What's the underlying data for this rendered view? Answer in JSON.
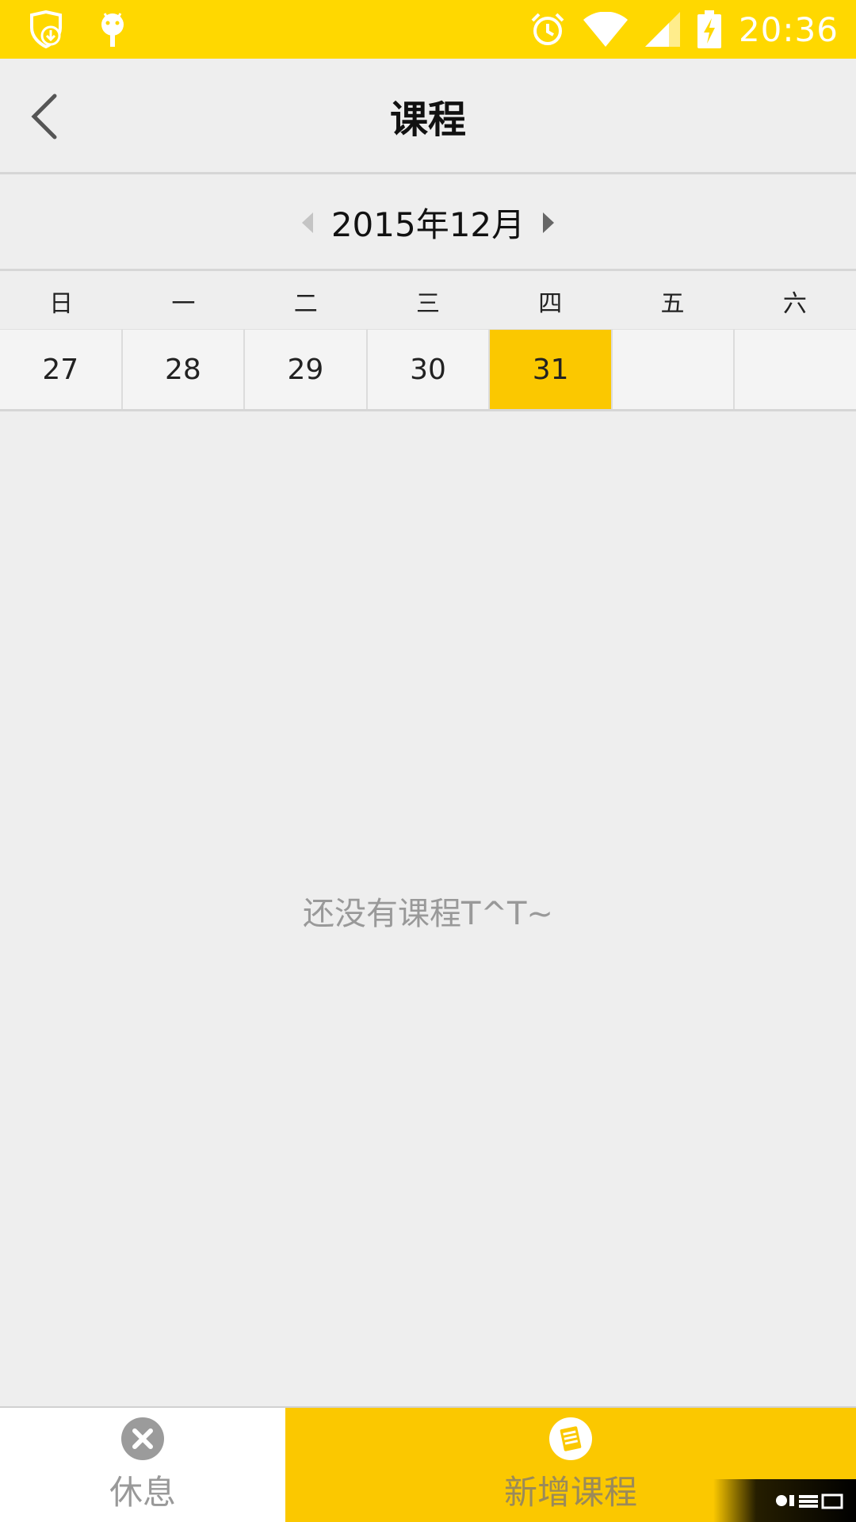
{
  "status_bar": {
    "time": "20:36",
    "left_icons": [
      "shield-download-icon",
      "android-icon"
    ],
    "right_icons": [
      "alarm-icon",
      "wifi-icon",
      "signal-icon",
      "battery-charging-icon"
    ],
    "background": "#ffd800"
  },
  "header": {
    "title": "课程",
    "back_icon": "chevron-left-icon"
  },
  "calendar": {
    "month_label": "2015年12月",
    "weekdays": [
      "日",
      "一",
      "二",
      "三",
      "四",
      "五",
      "六"
    ],
    "dates": [
      "27",
      "28",
      "29",
      "30",
      "31",
      "",
      ""
    ],
    "selected_date": "31",
    "selected_color": "#fbc800"
  },
  "content": {
    "empty_message": "还没有课程T^T~"
  },
  "bottom_bar": {
    "rest_label": "休息",
    "rest_icon": "close-circle-icon",
    "add_label": "新增课程",
    "add_icon": "notebook-icon",
    "add_color": "#fbc800"
  }
}
